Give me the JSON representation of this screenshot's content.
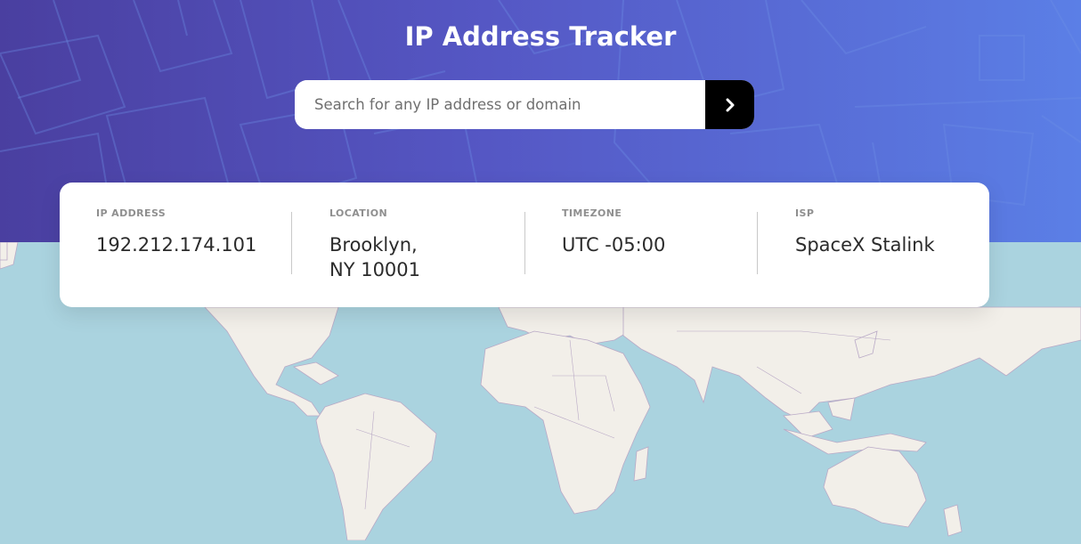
{
  "app": {
    "title": "IP Address Tracker"
  },
  "search": {
    "placeholder": "Search for any IP address or domain",
    "value": "",
    "submit_icon": "chevron-right-icon"
  },
  "info": {
    "ip": {
      "label": "IP ADDRESS",
      "value": "192.212.174.101"
    },
    "location": {
      "label": "LOCATION",
      "value": "Brooklyn,\nNY 10001"
    },
    "timezone": {
      "label": "TIMEZONE",
      "value": "UTC -05:00"
    },
    "isp": {
      "label": "ISP",
      "value": "SpaceX Stalink"
    }
  },
  "colors": {
    "header_gradient_start": "#4a3fa0",
    "header_gradient_end": "#5b7fe6",
    "ocean": "#aad3df",
    "land": "#f2efe9",
    "button": "#000000"
  }
}
